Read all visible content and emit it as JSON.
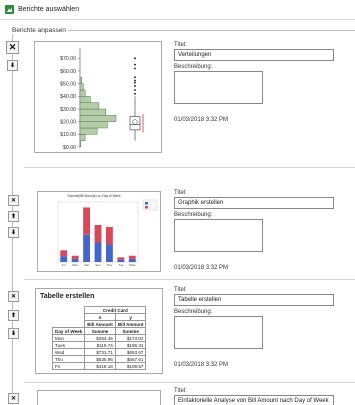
{
  "window": {
    "title": "Berichte auswählen"
  },
  "group": {
    "label": "Berichte anpassen"
  },
  "field_labels": {
    "title": "Titel:",
    "description": "Beschreibung:"
  },
  "reports": [
    {
      "title": "Verteilungen",
      "description": "",
      "date": "01/03/2018 3:32 PM"
    },
    {
      "title": "Graphik erstellen",
      "description": "",
      "date": "01/03/2018 3:32 PM"
    },
    {
      "title": "Tabelle erstellen",
      "description": "",
      "date": "01/03/2018 3:32 PM"
    },
    {
      "title": "Einfaktorielle Analyse von Bill Amount nach Day of Week",
      "description": "",
      "date": ""
    }
  ],
  "buttons": {
    "remove": "✕",
    "move_up": "⬆",
    "move_down": "⬇"
  },
  "chart_data": [
    {
      "type": "bar",
      "title": "",
      "ytick_labels": [
        "$70.00",
        "$60.00",
        "$50.00",
        "$40.00",
        "$30.00",
        "$20.00",
        "$10.00",
        "$0.00"
      ],
      "ylim": [
        0,
        75
      ],
      "histogram_bins": [
        {
          "from": 0,
          "to": 5,
          "count": 1
        },
        {
          "from": 5,
          "to": 10,
          "count": 6
        },
        {
          "from": 10,
          "to": 15,
          "count": 20
        },
        {
          "from": 15,
          "to": 20,
          "count": 32
        },
        {
          "from": 20,
          "to": 25,
          "count": 42
        },
        {
          "from": 25,
          "to": 30,
          "count": 30
        },
        {
          "from": 30,
          "to": 35,
          "count": 22
        },
        {
          "from": 35,
          "to": 40,
          "count": 12
        },
        {
          "from": 40,
          "to": 45,
          "count": 6
        },
        {
          "from": 45,
          "to": 50,
          "count": 4
        },
        {
          "from": 50,
          "to": 55,
          "count": 2
        }
      ],
      "boxplot": {
        "min": 5,
        "q1": 13.5,
        "median": 17.8,
        "q3": 24,
        "max": 40,
        "mean": 19.8,
        "outliers": [
          42,
          45,
          48.2,
          50.8,
          52.5,
          55,
          62,
          65,
          70
        ]
      }
    },
    {
      "type": "bar",
      "title": "Summe(Bill Amount) vs. Day of Week",
      "categories": [
        "Fri",
        "Mon",
        "Sat",
        "Sun",
        "Thu",
        "Tue",
        "Wed"
      ],
      "series": [
        {
          "name": "",
          "color": "#4466cc",
          "values": [
            150,
            80,
            700,
            500,
            450,
            60,
            80
          ]
        },
        {
          "name": "",
          "color": "#d9485a",
          "values": [
            150,
            80,
            700,
            450,
            450,
            60,
            80
          ]
        }
      ]
    }
  ],
  "crosstab": {
    "title": "Tabelle erstellen",
    "header_group": "Credit Card",
    "header_sub": [
      "n",
      "y"
    ],
    "col_labels": [
      "Bill Amount",
      "Bill Amount"
    ],
    "stat_labels": [
      "Summe",
      "Summe"
    ],
    "row_header": "Day of Week",
    "rows": [
      {
        "day": "Mon",
        "n": "$264.45",
        "y": "$173.02"
      },
      {
        "day": "Tues",
        "n": "$119.74",
        "y": "$196.31"
      },
      {
        "day": "Wed",
        "n": "$731.71",
        "y": "$653.67"
      },
      {
        "day": "Thu",
        "n": "$535.96",
        "y": "$567.61"
      },
      {
        "day": "Fri",
        "n": "$418.18",
        "y": "$109.57"
      }
    ]
  }
}
